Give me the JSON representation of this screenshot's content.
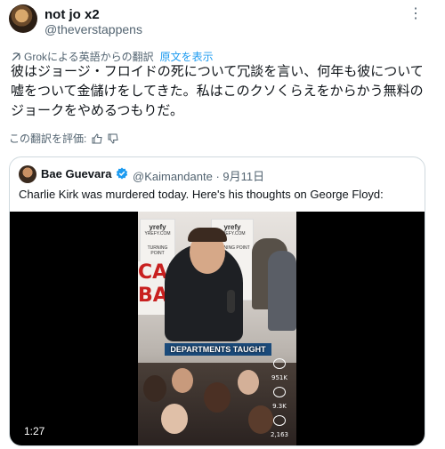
{
  "post": {
    "display_name": "not jo x2",
    "handle": "@theverstappens",
    "more_icon": "more-dots-icon",
    "translation_note": "Grokによる英語からの翻訳",
    "show_original": "原文を表示",
    "text": "彼はジョージ・フロイドの死について冗談を言い、何年も彼について嘘をついて金儲けをしてきた。私はこのクソくらえをからかう無料のジョークをやめるつもりだ。",
    "rate_translation": "この翻訳を評価:"
  },
  "quote": {
    "display_name": "Bae Guevara",
    "verified_icon": "verified-badge-icon",
    "handle": "@Kaimandante",
    "separator": "·",
    "date": "9月11日",
    "text": "Charlie Kirk was murdered today. Here's his thoughts on George Floyd:",
    "video": {
      "duration": "1:27",
      "banner_text": "yrefy",
      "banner_sub": "YREFY.COM",
      "turning_point": "TURNING POINT",
      "sign_letters": [
        "CAN",
        "BA"
      ],
      "caption": "DEPARTMENTS TAUGHT",
      "side_counts": [
        "951K",
        "9.3K",
        "2,163"
      ]
    }
  },
  "colors": {
    "accent": "#1d9bf0",
    "muted": "#536471",
    "text": "#0f1419",
    "border": "#cfd9de"
  }
}
